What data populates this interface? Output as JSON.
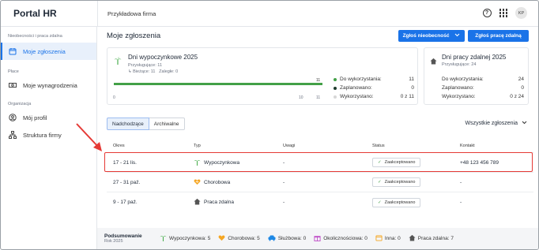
{
  "app": {
    "title": "Portal HR",
    "company": "Przykładowa firma",
    "user_initials": "KP"
  },
  "colors": {
    "accent": "#1a73e8",
    "success": "#43a047",
    "highlight": "#e53935"
  },
  "sidebar": {
    "sections": [
      {
        "title": "Nieobecności i praca zdalna",
        "items": [
          {
            "label": "Moje zgłoszenia",
            "icon": "calendar-icon",
            "active": true
          }
        ]
      },
      {
        "title": "Płace",
        "items": [
          {
            "label": "Moje wynagrodzenia",
            "icon": "cash-icon",
            "active": false
          }
        ]
      },
      {
        "title": "Organizacja",
        "items": [
          {
            "label": "Mój profil",
            "icon": "user-icon",
            "active": false
          },
          {
            "label": "Struktura firmy",
            "icon": "org-chart-icon",
            "active": false
          }
        ]
      }
    ]
  },
  "main": {
    "title": "Moje zgłoszenia",
    "btn_absence": "Zgłoś nieobecność",
    "btn_remote": "Zgłoś pracę zdalną"
  },
  "vacation": {
    "title": "Dni wypoczynkowe 2025",
    "entitled": "Przysługujące: 11",
    "current": "Bieżące: 11",
    "overdue": "Zaległe: 0",
    "bar_value": "11",
    "bar_fill_fraction": 1.0,
    "axis": [
      "0",
      "10",
      "11"
    ],
    "stats": [
      {
        "label": "Do wykorzystania:",
        "value": "11"
      },
      {
        "label": "Zaplanowano:",
        "value": "0"
      },
      {
        "label": "Wykorzystano:",
        "value": "0 z 11"
      }
    ]
  },
  "remote": {
    "title": "Dni pracy zdalnej 2025",
    "entitled": "Przysługujące: 24",
    "stats": [
      {
        "label": "Do wykorzystania:",
        "value": "24"
      },
      {
        "label": "Zaplanowano:",
        "value": "0"
      },
      {
        "label": "Wykorzystano:",
        "value": "0 z 24"
      }
    ]
  },
  "tabs": {
    "upcoming": "Nadchodzące",
    "archived": "Archiwalne"
  },
  "filter": {
    "label": "Wszystkie zgłoszenia"
  },
  "table": {
    "headers": [
      "Okres",
      "Typ",
      "Uwagi",
      "Status",
      "Kontakt"
    ],
    "rows": [
      {
        "period": "17 - 21 lis.",
        "type": "Wypoczynkowa",
        "type_icon": "palm-icon",
        "notes": "-",
        "status": "Zaakceptowano",
        "contact": "+48 123 456 789"
      },
      {
        "period": "27 - 31 paź.",
        "type": "Chorobowa",
        "type_icon": "heart-icon",
        "notes": "-",
        "status": "Zaakceptowano",
        "contact": "-"
      },
      {
        "period": "9 - 17 paź.",
        "type": "Praca zdalna",
        "type_icon": "home-icon",
        "notes": "-",
        "status": "Zaakceptowano",
        "contact": "-"
      }
    ]
  },
  "summary": {
    "title": "Podsumowanie",
    "year": "Rok 2025",
    "items": [
      {
        "label": "Wypoczynkowa: 5",
        "icon": "palm-icon"
      },
      {
        "label": "Chorobowa: 5",
        "icon": "heart-icon"
      },
      {
        "label": "Służbowa: 0",
        "icon": "car-icon"
      },
      {
        "label": "Okolicznościowa: 0",
        "icon": "gift-icon"
      },
      {
        "label": "Inna: 0",
        "icon": "calendar-icon"
      },
      {
        "label": "Praca zdalna: 7",
        "icon": "home-icon"
      }
    ]
  }
}
